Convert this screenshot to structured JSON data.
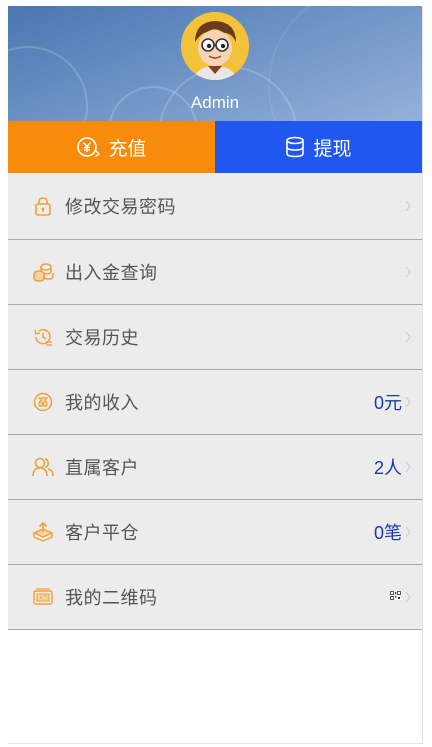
{
  "header": {
    "username": "Admin"
  },
  "actions": {
    "recharge_label": "充值",
    "withdraw_label": "提现",
    "recharge_color": "#f88c0a",
    "withdraw_color": "#1f57f0"
  },
  "menu": {
    "items": [
      {
        "label": "修改交易密码",
        "icon": "lock-icon",
        "value": ""
      },
      {
        "label": "出入金查询",
        "icon": "coins-icon",
        "value": ""
      },
      {
        "label": "交易历史",
        "icon": "history-clock-icon",
        "value": ""
      },
      {
        "label": "我的收入",
        "icon": "money-bag-icon",
        "value": "0元"
      },
      {
        "label": "直属客户",
        "icon": "users-icon",
        "value": "2人"
      },
      {
        "label": "客户平仓",
        "icon": "upload-box-icon",
        "value": "0笔"
      },
      {
        "label": "我的二维码",
        "icon": "qrcode-card-icon",
        "value": ""
      }
    ],
    "icon_color": "#f0a03c",
    "value_color": "#1a3aa8"
  }
}
